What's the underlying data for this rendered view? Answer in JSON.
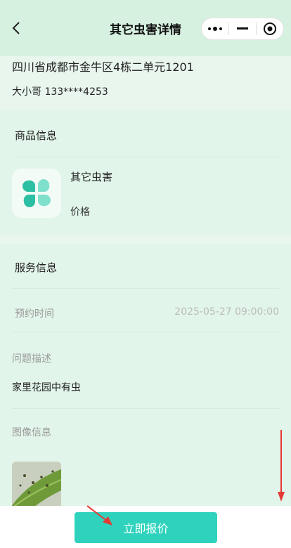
{
  "nav": {
    "title": "其它虫害详情",
    "back_icon": "chevron-left-icon",
    "more_icon": "more-dots-icon",
    "minimize_icon": "minimize-icon",
    "close_icon": "target-close-icon"
  },
  "address": {
    "line": "四川省成都市金牛区4栋二单元1201",
    "contact": "大小哥 133****4253"
  },
  "goods": {
    "section_title": "商品信息",
    "name": "其它虫害",
    "price_label": "价格",
    "icon": "four-petal-leaf-icon"
  },
  "service": {
    "section_title": "服务信息",
    "appointment_label": "预约时间",
    "appointment_value": "2025-05-27 09:00:00",
    "problem_label": "问题描述",
    "problem_text": "家里花园中有虫",
    "image_label": "图像信息"
  },
  "action": {
    "quote_label": "立即报价"
  },
  "colors": {
    "accent": "#2fd3bd",
    "background": "#e8f6ee",
    "annotation_arrow": "#e53935"
  }
}
